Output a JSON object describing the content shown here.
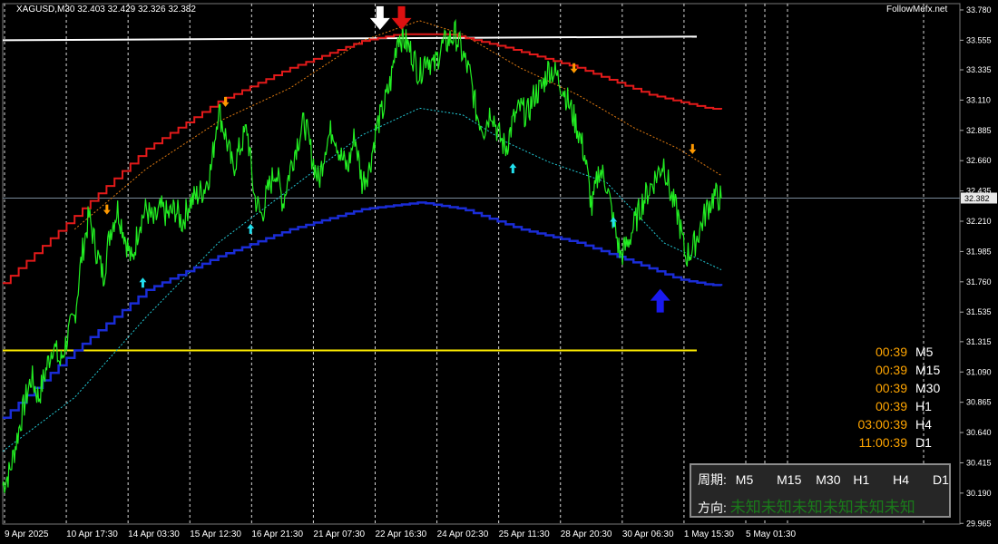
{
  "header": {
    "ohlc_text": "XAGUSD,M30  32.403 32.429 32.326 32.382",
    "brand": "FollowMefx.net"
  },
  "colors": {
    "background": "#000000",
    "price": "#22ee22",
    "ma_red": "#e31a1a",
    "ma_blue": "#1a2cd6",
    "band_orange": "#e07a10",
    "band_cyan": "#22c8d4",
    "line_white": "#ffffff",
    "line_yellow": "#ffee00",
    "grid": "#ffffff",
    "arrow_up_cyan": "#22e0ee",
    "arrow_down_orange": "#ff9900",
    "big_arrow_white": "#ffffff",
    "big_arrow_red": "#dd1111",
    "big_arrow_blue": "#1a1aee"
  },
  "countdown": [
    {
      "time": "00:39",
      "tf": "M5"
    },
    {
      "time": "00:39",
      "tf": "M15"
    },
    {
      "time": "00:39",
      "tf": "M30"
    },
    {
      "time": "00:39",
      "tf": "H1"
    },
    {
      "time": "03:00:39",
      "tf": "H4"
    },
    {
      "time": "11:00:39",
      "tf": "D1"
    }
  ],
  "panel": {
    "period_label": "周期:",
    "periods": [
      "M5",
      "M15",
      "M30",
      "H1",
      "H4",
      "D1"
    ],
    "direction_label": "方向:",
    "direction_values": "未知未知未知未知未知未知"
  },
  "chart_data": {
    "type": "line",
    "symbol": "XAGUSD",
    "timeframe": "M30",
    "current_price": "32.382",
    "ylim": [
      29.96,
      33.8
    ],
    "yticks": [
      "33.780",
      "33.555",
      "33.335",
      "33.110",
      "32.885",
      "32.660",
      "32.435",
      "32.210",
      "31.985",
      "31.760",
      "31.535",
      "31.315",
      "31.090",
      "30.865",
      "30.640",
      "30.415",
      "30.190",
      "29.965"
    ],
    "xticks": [
      "9 Apr 2025",
      "10 Apr 17:30",
      "14 Apr 03:30",
      "15 Apr 12:30",
      "16 Apr 21:30",
      "21 Apr 07:30",
      "22 Apr 16:30",
      "24 Apr 02:30",
      "25 Apr 11:30",
      "28 Apr 20:30",
      "30 Apr 06:30",
      "1 May 15:30",
      "5 May 01:30"
    ],
    "xrange": [
      0,
      100
    ],
    "price_series": [
      [
        0,
        30.25
      ],
      [
        1,
        30.35
      ],
      [
        2,
        30.6
      ],
      [
        3,
        30.85
      ],
      [
        4,
        31.05
      ],
      [
        5,
        30.9
      ],
      [
        6,
        31.1
      ],
      [
        7,
        31.3
      ],
      [
        8,
        31.15
      ],
      [
        9,
        31.35
      ],
      [
        10,
        31.5
      ],
      [
        11,
        31.95
      ],
      [
        12,
        32.25
      ],
      [
        13,
        32.0
      ],
      [
        14,
        31.8
      ],
      [
        15,
        32.15
      ],
      [
        16,
        32.3
      ],
      [
        17,
        32.1
      ],
      [
        18,
        31.9
      ],
      [
        19,
        32.2
      ],
      [
        20,
        32.3
      ],
      [
        21,
        32.2
      ],
      [
        22,
        32.3
      ],
      [
        23,
        32.25
      ],
      [
        24,
        32.3
      ],
      [
        25,
        32.2
      ],
      [
        26,
        32.35
      ],
      [
        27,
        32.4
      ],
      [
        28,
        32.45
      ],
      [
        29,
        32.6
      ],
      [
        30,
        33.05
      ],
      [
        31,
        32.85
      ],
      [
        32,
        32.6
      ],
      [
        33,
        32.75
      ],
      [
        34,
        32.9
      ],
      [
        35,
        32.4
      ],
      [
        36,
        32.25
      ],
      [
        37,
        32.45
      ],
      [
        38,
        32.6
      ],
      [
        39,
        32.35
      ],
      [
        40,
        32.6
      ],
      [
        41,
        32.8
      ],
      [
        42,
        32.95
      ],
      [
        43,
        32.7
      ],
      [
        44,
        32.5
      ],
      [
        45,
        32.8
      ],
      [
        46,
        32.9
      ],
      [
        47,
        32.7
      ],
      [
        48,
        32.6
      ],
      [
        49,
        32.85
      ],
      [
        50,
        32.5
      ],
      [
        51,
        32.6
      ],
      [
        52,
        32.9
      ],
      [
        53,
        33.05
      ],
      [
        54,
        33.25
      ],
      [
        55,
        33.6
      ],
      [
        56,
        33.55
      ],
      [
        57,
        33.45
      ],
      [
        58,
        33.3
      ],
      [
        59,
        33.45
      ],
      [
        60,
        33.35
      ],
      [
        61,
        33.5
      ],
      [
        62,
        33.55
      ],
      [
        63,
        33.6
      ],
      [
        64,
        33.45
      ],
      [
        65,
        33.3
      ],
      [
        66,
        33.0
      ],
      [
        67,
        32.9
      ],
      [
        68,
        33.05
      ],
      [
        69,
        32.85
      ],
      [
        70,
        32.75
      ],
      [
        71,
        32.95
      ],
      [
        72,
        33.05
      ],
      [
        73,
        33.0
      ],
      [
        74,
        33.15
      ],
      [
        75,
        33.2
      ],
      [
        76,
        33.35
      ],
      [
        77,
        33.3
      ],
      [
        78,
        33.2
      ],
      [
        79,
        33.05
      ],
      [
        80,
        32.9
      ],
      [
        81,
        32.7
      ],
      [
        82,
        32.3
      ],
      [
        83,
        32.6
      ],
      [
        84,
        32.5
      ],
      [
        85,
        32.2
      ],
      [
        86,
        31.95
      ],
      [
        87,
        32.05
      ],
      [
        88,
        32.2
      ],
      [
        89,
        32.35
      ],
      [
        90,
        32.45
      ],
      [
        91,
        32.55
      ],
      [
        92,
        32.65
      ],
      [
        93,
        32.4
      ],
      [
        94,
        32.25
      ],
      [
        95,
        31.95
      ],
      [
        96,
        32.0
      ],
      [
        97,
        32.15
      ],
      [
        98,
        32.3
      ],
      [
        99,
        32.4
      ],
      [
        100,
        32.38
      ]
    ],
    "ma_red": [
      [
        0,
        31.75
      ],
      [
        10,
        32.25
      ],
      [
        20,
        32.75
      ],
      [
        30,
        33.1
      ],
      [
        40,
        33.35
      ],
      [
        50,
        33.55
      ],
      [
        55,
        33.6
      ],
      [
        62,
        33.6
      ],
      [
        70,
        33.5
      ],
      [
        80,
        33.35
      ],
      [
        90,
        33.15
      ],
      [
        98,
        33.05
      ],
      [
        100,
        33.04
      ]
    ],
    "ma_blue": [
      [
        0,
        30.75
      ],
      [
        10,
        31.25
      ],
      [
        20,
        31.7
      ],
      [
        30,
        31.95
      ],
      [
        40,
        32.15
      ],
      [
        50,
        32.3
      ],
      [
        58,
        32.35
      ],
      [
        64,
        32.3
      ],
      [
        72,
        32.15
      ],
      [
        80,
        32.05
      ],
      [
        88,
        31.9
      ],
      [
        94,
        31.78
      ],
      [
        98,
        31.74
      ],
      [
        100,
        31.73
      ]
    ],
    "band_upper": [
      [
        10,
        32.15
      ],
      [
        20,
        32.6
      ],
      [
        30,
        32.95
      ],
      [
        40,
        33.2
      ],
      [
        50,
        33.55
      ],
      [
        58,
        33.7
      ],
      [
        64,
        33.6
      ],
      [
        72,
        33.35
      ],
      [
        80,
        33.15
      ],
      [
        88,
        32.9
      ],
      [
        94,
        32.75
      ],
      [
        100,
        32.55
      ]
    ],
    "band_lower": [
      [
        0,
        30.5
      ],
      [
        10,
        30.9
      ],
      [
        20,
        31.5
      ],
      [
        30,
        32.05
      ],
      [
        40,
        32.45
      ],
      [
        50,
        32.85
      ],
      [
        58,
        33.05
      ],
      [
        64,
        33.0
      ],
      [
        70,
        32.8
      ],
      [
        76,
        32.65
      ],
      [
        84,
        32.5
      ],
      [
        92,
        32.05
      ],
      [
        100,
        31.85
      ]
    ],
    "level_white": 33.555,
    "level_yellow": 31.25,
    "arrows_up_cyan": [
      [
        19.5,
        31.75
      ],
      [
        34.5,
        32.15
      ],
      [
        71,
        32.6
      ],
      [
        85,
        32.2
      ]
    ],
    "arrows_down_orange": [
      [
        14.5,
        32.3
      ],
      [
        31,
        33.1
      ],
      [
        79.5,
        33.35
      ],
      [
        96,
        32.75
      ]
    ],
    "big_arrow_white_down": [
      52.5,
      33.72
    ],
    "big_arrow_red_down": [
      55.5,
      33.72
    ],
    "big_arrow_blue_up": [
      91.5,
      31.62
    ]
  }
}
